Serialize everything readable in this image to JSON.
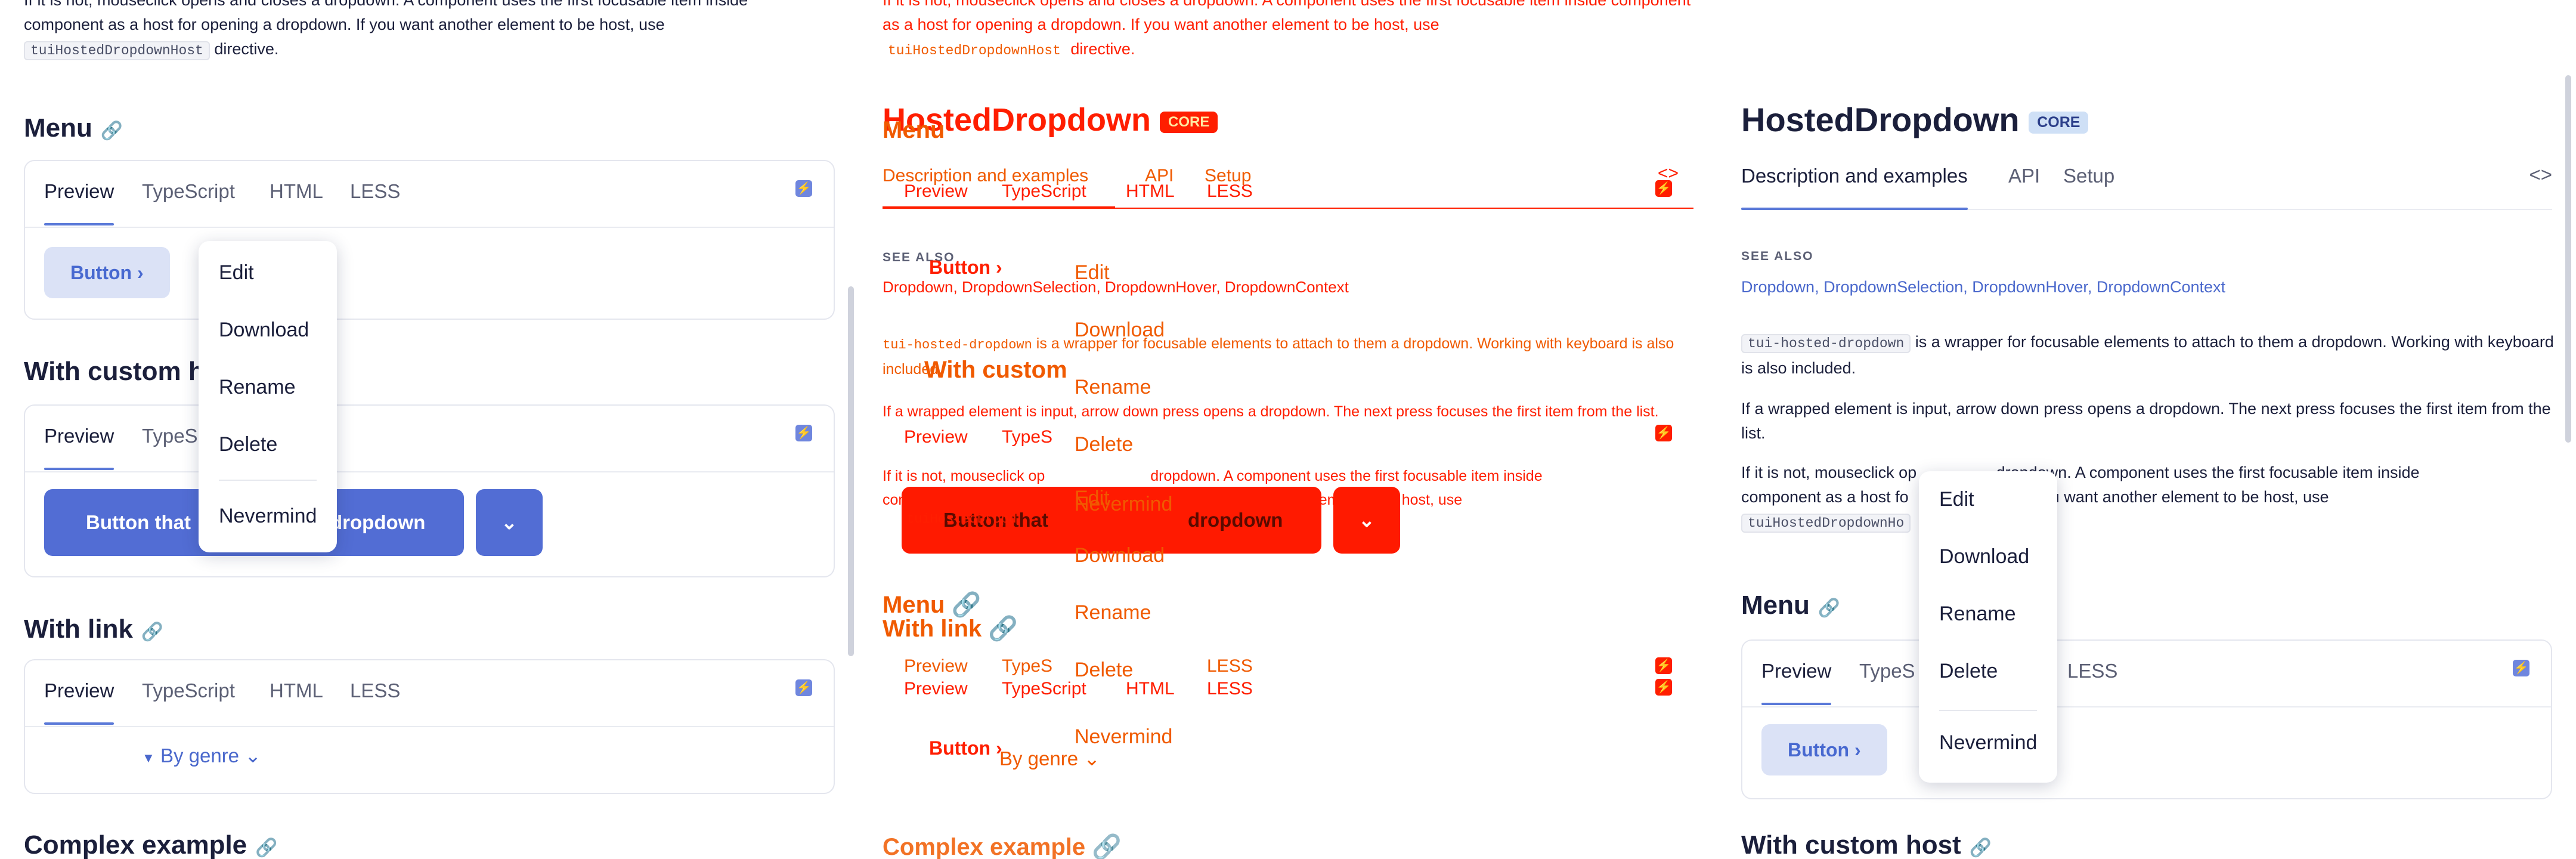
{
  "colors": {
    "accent": "#526dd4",
    "accent_light": "#dbe2f6",
    "text": "#1b1f3b",
    "muted": "#5c6075",
    "overlay_red": "#ff1e00",
    "overlay_orange": "#f05a00",
    "badge_bg": "#cfe0f6"
  },
  "page": {
    "title": "HostedDropdown",
    "badge": "CORE",
    "tabs": [
      "Description and examples",
      "API",
      "Setup"
    ],
    "code_toggle": "<>",
    "see_also_label": "SEE ALSO",
    "see_also": [
      "Dropdown",
      "DropdownSelection",
      "DropdownHover",
      "DropdownContext"
    ]
  },
  "desc": {
    "tag": "tui-hosted-dropdown",
    "p1_rest": "is a wrapper for focusable elements to attach to them a dropdown. Working with keyboard is also included.",
    "p2": "If a wrapped element is input, arrow down press opens a dropdown. The next press focuses the first item from the list.",
    "p3": "If it is not, mouseclick opens and closes a dropdown. A component uses the first focusable item inside component as a host for opening a dropdown. If you want another element to be host, use",
    "p3_tail": "If it is not, mouseclick opens and closes a dropdown. A component uses the first focusable item inside",
    "p3_mid": "component as a host for opening a dropdown. If you want another element to be host, use",
    "directive_code": "tuiHostedDropdownHost",
    "directive_word": "directive."
  },
  "sections": {
    "menu": "Menu",
    "custom_host": "With custom host",
    "with_link": "With link",
    "complex": "Complex example",
    "link_icon": "🔗"
  },
  "demo_tabs": [
    "Preview",
    "TypeScript",
    "HTML",
    "LESS"
  ],
  "menu_items": [
    "Edit",
    "Download",
    "Rename",
    "Delete",
    "Nevermind"
  ],
  "buttons": {
    "button": "Button",
    "custom_host": "Button that",
    "custom_host_tail": "dropdown",
    "by_genre": "By genre"
  },
  "fragments": {
    "custom_head": "With custom h",
    "types": "TypeS",
    "with_custom_frag": "With custom",
    "button_that_frag": "Button that",
    "tui_frag": "tuiHostedDropd",
    "p3_frag_a": "If it is not, mouseclick op",
    "p3_frag_b": "dropdown. A component uses the first focusable item inside",
    "p3_frag_c": "component as a host fo",
    "p3_frag_d": "wn. If you want another element to be host, use",
    "host_code_frag": "tuiHostedDropdownHo",
    "complex_ghost": "Complex example"
  }
}
